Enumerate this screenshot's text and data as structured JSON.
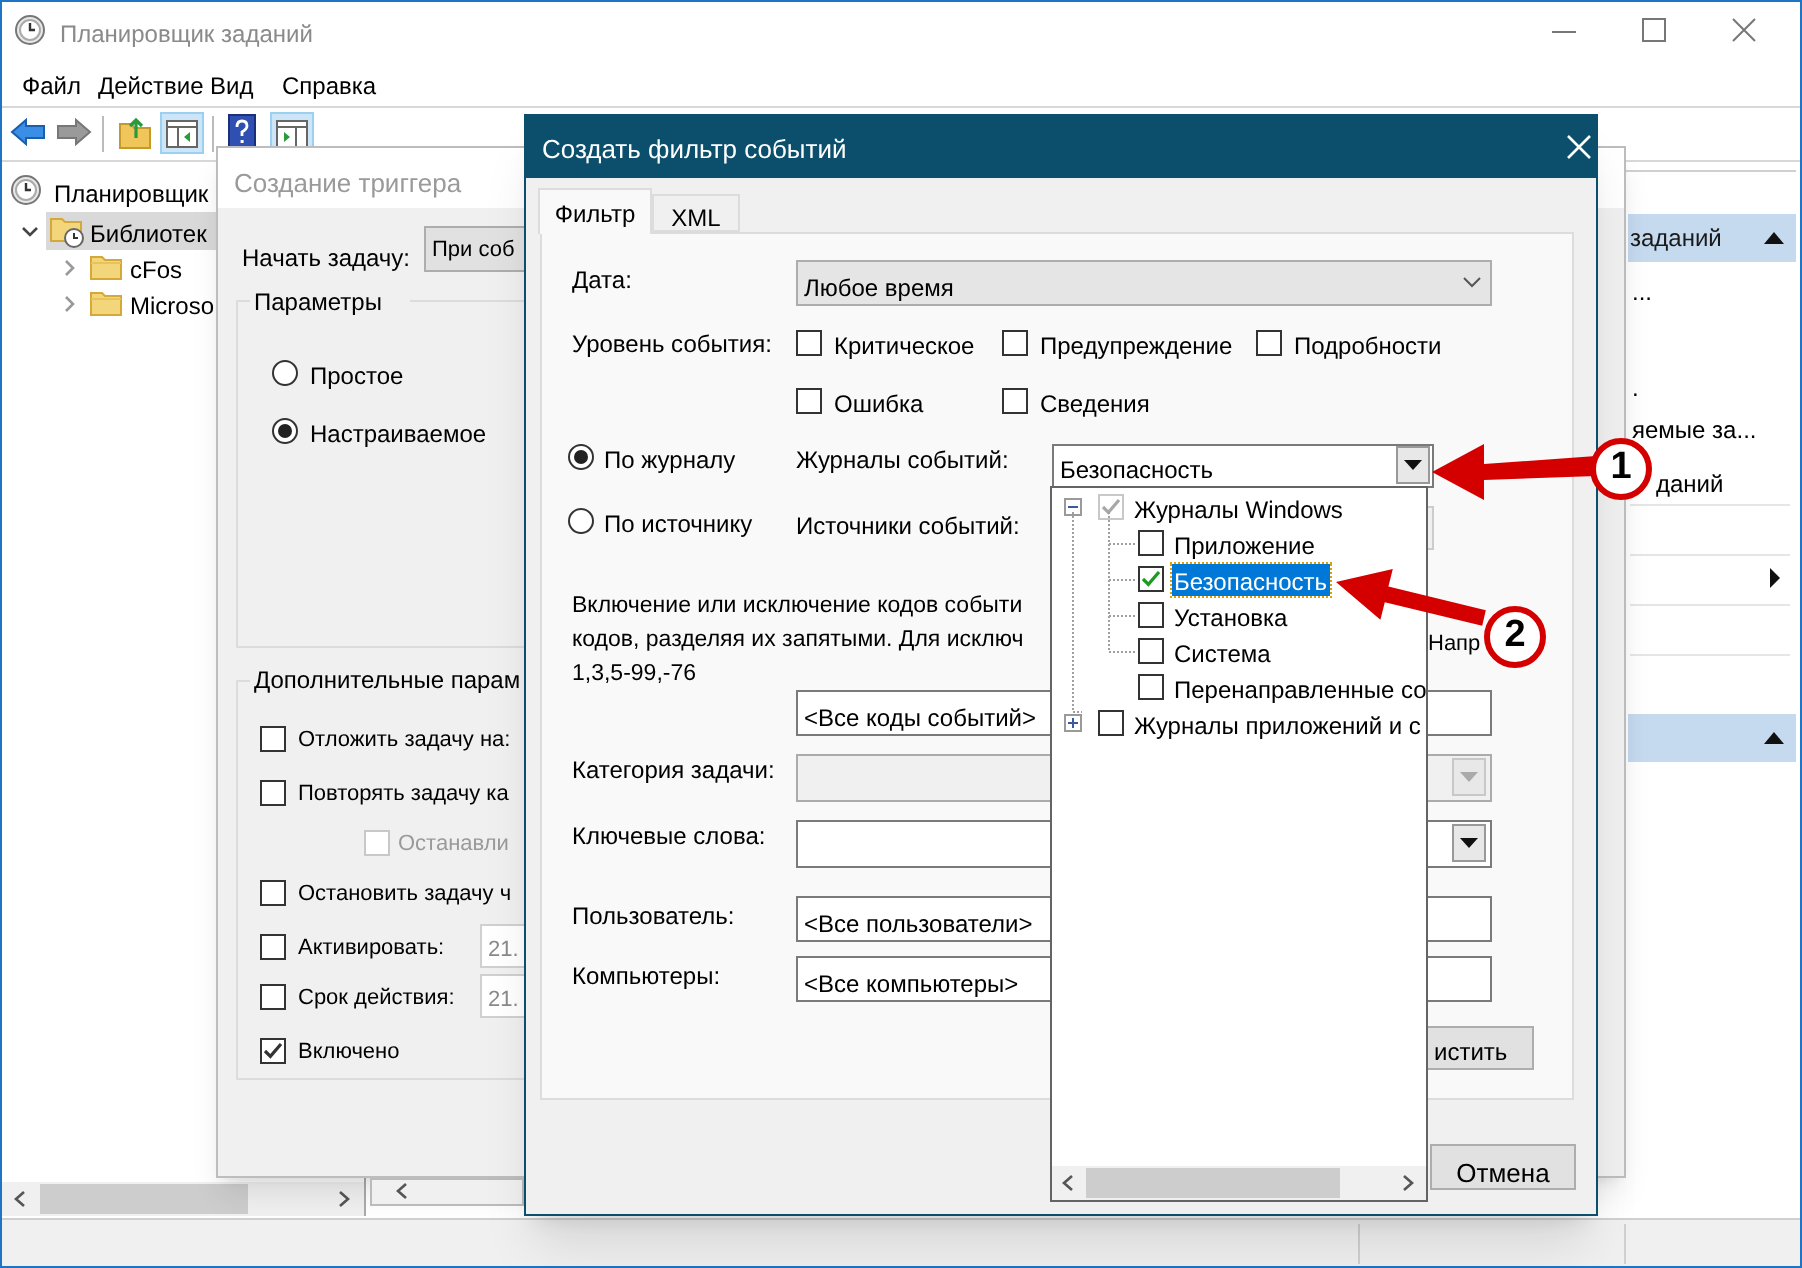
{
  "main_window": {
    "title": "Планировщик заданий",
    "menu": [
      "Файл",
      "Действие",
      "Вид",
      "Справка"
    ],
    "tree": [
      {
        "label": "Планировщик",
        "selected": false,
        "children": [
          {
            "label": "Библиотек",
            "selected": true,
            "expanded": true,
            "children": [
              {
                "label": "cFos",
                "selected": false,
                "expanded": false
              },
              {
                "label": "Microso",
                "selected": false,
                "expanded": false
              }
            ]
          }
        ]
      }
    ],
    "actions_panel": {
      "section_title": "заданий",
      "items": [
        "...",
        ".",
        "яемые за...",
        "даний"
      ]
    }
  },
  "trigger_dialog": {
    "title": "Создание триггера",
    "start_label": "Начать задачу:",
    "start_value": "При соб",
    "settings_group": "Параметры",
    "schedule": [
      {
        "label": "Простое",
        "selected": false
      },
      {
        "label": "Настраиваемое",
        "selected": true
      }
    ],
    "advanced_group": "Дополнительные парам",
    "options": [
      {
        "label": "Отложить задачу на:",
        "checked": false,
        "disabled": false
      },
      {
        "label": "Повторять задачу ка",
        "checked": false,
        "disabled": false
      },
      {
        "label": "Останавли",
        "checked": false,
        "disabled": true
      },
      {
        "label": "Остановить задачу ч",
        "checked": false,
        "disabled": false
      },
      {
        "label": "Активировать:",
        "checked": false,
        "disabled": false,
        "value": "21."
      },
      {
        "label": "Срок действия:",
        "checked": false,
        "disabled": false,
        "value": "21."
      },
      {
        "label": "Включено",
        "checked": true,
        "disabled": false
      }
    ]
  },
  "filter_dialog": {
    "title": "Создать фильтр событий",
    "tabs": [
      {
        "label": "Фильтр",
        "selected": true
      },
      {
        "label": "XML",
        "selected": false
      }
    ],
    "date_label": "Дата:",
    "date_value": "Любое время",
    "level_label": "Уровень события:",
    "levels": [
      {
        "label": "Критическое",
        "checked": false
      },
      {
        "label": "Предупреждение",
        "checked": false
      },
      {
        "label": "Подробности",
        "checked": false
      },
      {
        "label": "Ошибка",
        "checked": false
      },
      {
        "label": "Сведения",
        "checked": false
      }
    ],
    "source_mode": [
      {
        "label": "По журналу",
        "selected": true
      },
      {
        "label": "По источнику",
        "selected": false
      }
    ],
    "logs_label": "Журналы событий:",
    "logs_value": "Безопасность",
    "sources_label": "Источники событий:",
    "hint_lines": [
      "Включение или исключение кодов событи",
      "кодов, разделяя их запятыми. Для исключ",
      "1,3,5-99,-76"
    ],
    "hint_fragments": [
      "Напр"
    ],
    "event_ids_value": "<Все коды событий>",
    "category_label": "Категория задачи:",
    "category_disabled": true,
    "keywords_label": "Ключевые слова:",
    "user_label": "Пользователь:",
    "user_value": "<Все пользователи>",
    "computers_label": "Компьютеры:",
    "computers_value": "<Все компьютеры>",
    "clear_button": "истить",
    "cancel_button": "Отмена",
    "log_tree": [
      {
        "label": "Журналы Windows",
        "expanded": true,
        "checked": true,
        "partial": true,
        "selected": false,
        "children": [
          {
            "label": "Приложение",
            "checked": false,
            "selected": false
          },
          {
            "label": "Безопасность",
            "checked": true,
            "selected": true
          },
          {
            "label": "Установка",
            "checked": false,
            "selected": false
          },
          {
            "label": "Система",
            "checked": false,
            "selected": false
          },
          {
            "label": "Перенаправленные со",
            "checked": false,
            "selected": false
          }
        ]
      },
      {
        "label": "Журналы приложений и с",
        "expanded": false,
        "checked": false,
        "partial": false,
        "selected": false
      }
    ]
  },
  "annotations": [
    {
      "label": "1"
    },
    {
      "label": "2"
    }
  ]
}
